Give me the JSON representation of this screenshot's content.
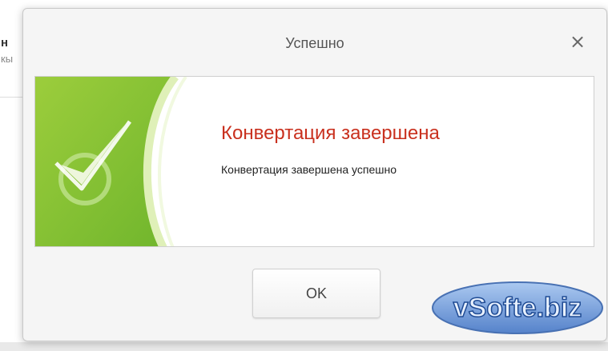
{
  "background": {
    "fragment_line1": "н",
    "fragment_line2": "кы"
  },
  "dialog": {
    "title": "Успешно",
    "close_glyph": "×",
    "message_heading": "Конвертация завершена",
    "message_body": "Конвертация завершена успешно",
    "ok_label": "OK",
    "heading_color": "#c9301e",
    "accent_green": "#8cc63f"
  },
  "watermark": {
    "text": "vSofte.biz"
  }
}
